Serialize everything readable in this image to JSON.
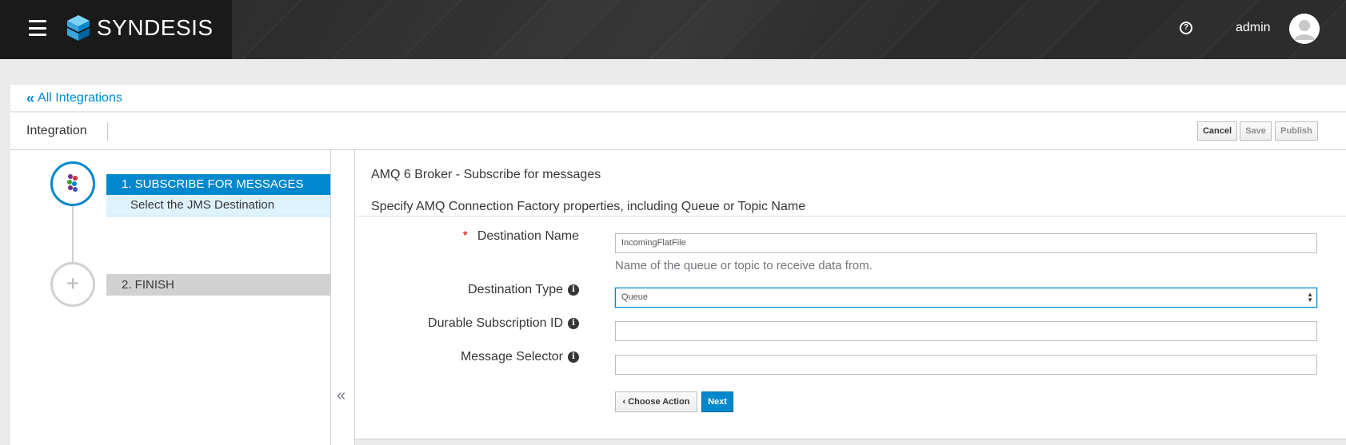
{
  "topbar": {
    "brand": "SYNDESIS",
    "user": "admin",
    "help_icon": "question-circle-icon",
    "menu_icon": "hamburger-icon"
  },
  "breadcrumb": {
    "label": "All Integrations"
  },
  "header": {
    "title": "Integration",
    "cancel_label": "Cancel",
    "save_label": "Save",
    "publish_label": "Publish"
  },
  "flow": {
    "steps": [
      {
        "label": "1. SUBSCRIBE FOR MESSAGES",
        "sub": "Select the JMS Destination",
        "state": "active"
      },
      {
        "label": "2. FINISH",
        "icon": "plus-icon",
        "state": "pending"
      }
    ],
    "collapse_icon": "double-chevron-left-icon"
  },
  "form": {
    "title": "AMQ 6 Broker - Subscribe for messages",
    "description": "Specify AMQ Connection Factory properties, including Queue or Topic Name",
    "fields": [
      {
        "label": "Destination Name",
        "required": true,
        "value": "IncomingFlatFile",
        "help": "Name of the queue or topic to receive data from."
      },
      {
        "label": "Destination Type",
        "value": "Queue"
      },
      {
        "label": "Durable Subscription ID",
        "value": ""
      },
      {
        "label": "Message Selector",
        "value": ""
      }
    ],
    "choose_action_label": "Choose Action",
    "next_label": "Next"
  },
  "colors": {
    "accent": "#0088ce",
    "nav_bg": "#2b2b2b",
    "required": "#cc0000"
  }
}
